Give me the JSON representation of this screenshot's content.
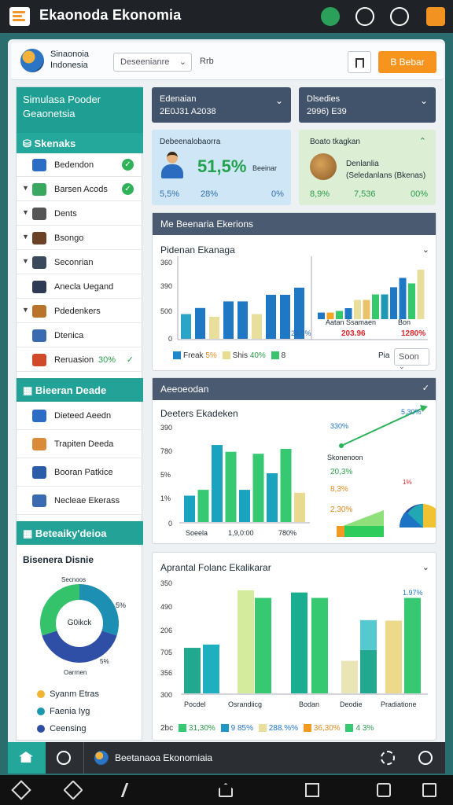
{
  "app": {
    "title": "Ekaonoda Ekonomia"
  },
  "header": {
    "org_line1": "Sinaonoia",
    "org_line2": "Indonesia",
    "dropdown": "Deseenianre",
    "text": "Rrb",
    "button": "B Bebar"
  },
  "sidebar": {
    "title_line1": "Simulasa Pooder",
    "title_line2": "Geaonetsia",
    "group1": "Skenaks",
    "items": [
      {
        "label": "Bedendon",
        "check": true,
        "caret": false
      },
      {
        "label": "Barsen Acods",
        "check": true,
        "caret": true
      },
      {
        "label": "Dents",
        "check": false,
        "caret": true
      },
      {
        "label": "Bsongo",
        "check": false,
        "caret": true
      },
      {
        "label": "Seconrian",
        "check": false,
        "caret": true
      },
      {
        "label": "Anecla Uegand",
        "check": false,
        "caret": false
      },
      {
        "label": "Pdedenkers",
        "check": false,
        "caret": true
      },
      {
        "label": "Dtenica",
        "check": false,
        "caret": false
      },
      {
        "label": "Reruasion",
        "badge": "30%",
        "check": false,
        "caret": false
      }
    ],
    "group2": "Bieeran Deade",
    "items2": [
      {
        "label": "Dieteed Aeedn"
      },
      {
        "label": "Trapiten Deeda"
      },
      {
        "label": "Booran Patkice"
      },
      {
        "label": "Necleae Ekerass"
      }
    ],
    "group3": "Beteaiky'deioa",
    "donut_title": "Bisenera Disnie",
    "donut_top": "Secnoos",
    "donut_center": "G0ikck",
    "donut_right": "5%",
    "donut_r2": "5%",
    "donut_bottom": "Oarrnen",
    "donut_legend": [
      {
        "label": "Syanm Etras",
        "color": "#f1b431"
      },
      {
        "label": "Faenia Iyg",
        "color": "#1b98b0"
      },
      {
        "label": "Ceensing",
        "color": "#2d4fa1"
      }
    ],
    "donut_values": [
      0.3,
      0.4,
      0.3
    ],
    "donut_colors": [
      "#1d8fb2",
      "#2f4ea6",
      "#34c36b"
    ]
  },
  "dropdowns": [
    {
      "label": "Edenaian",
      "value": "2E0J31 A2038"
    },
    {
      "label": "Dlsedies",
      "value": "2996) E39"
    }
  ],
  "cards": [
    {
      "title": "Debeenalobaorra",
      "value": "51,5%",
      "suffix": "Beeinar",
      "stats": [
        "5,5%",
        "28%",
        "0%"
      ]
    },
    {
      "title": "Boato tkagkan",
      "line1": "Denlanlia",
      "line2": "(Seledanlans (Bkenas)",
      "stats": [
        "8,9%",
        "7,536",
        "00%"
      ]
    }
  ],
  "panel1": {
    "title": "Me Beenaria Ekerions",
    "subtitle": "Pidenan Ekanaga",
    "yticks": [
      "360",
      "390",
      "500",
      "0"
    ],
    "legend": [
      {
        "label": "Freak",
        "pct": "5%",
        "color": "#1e88c8"
      },
      {
        "label": "Shis",
        "pct": "40%",
        "color": "#e9dd8f"
      },
      {
        "label": "",
        "pct": "8",
        "color": "#37c46d"
      }
    ],
    "bar_label": "29,5%",
    "sub_label1": "Aatan Ssamaen",
    "sub_label2": "Bon",
    "val1": "203.96",
    "val2": "1280%",
    "filter_label": "Pia",
    "filter_value": "Soon",
    "series1": [
      {
        "v": 0.45,
        "c": "#2aa4c7"
      },
      {
        "v": 0.56,
        "c": "#1e78c4"
      },
      {
        "v": 0.4,
        "c": "#e9df9c"
      },
      {
        "v": 0.68,
        "c": "#1e78c4"
      },
      {
        "v": 0.68,
        "c": "#1e78c4"
      },
      {
        "v": 0.45,
        "c": "#e9df9c"
      },
      {
        "v": 0.8,
        "c": "#1e78c4"
      },
      {
        "v": 0.8,
        "c": "#1e78c4"
      },
      {
        "v": 0.93,
        "c": "#1e78c4"
      }
    ],
    "series2": [
      {
        "v": 0.12,
        "c": "#1e78c4"
      },
      {
        "v": 0.12,
        "c": "#f2a623"
      },
      {
        "v": 0.15,
        "c": "#36c96b"
      },
      {
        "v": 0.2,
        "c": "#1e78c4"
      },
      {
        "v": 0.35,
        "c": "#e9df9c"
      },
      {
        "v": 0.35,
        "c": "#e9c36a"
      },
      {
        "v": 0.45,
        "c": "#36c96b"
      },
      {
        "v": 0.45,
        "c": "#1e98b3"
      },
      {
        "v": 0.58,
        "c": "#1e78c4"
      },
      {
        "v": 0.75,
        "c": "#1e78c4"
      },
      {
        "v": 0.65,
        "c": "#36c96b"
      },
      {
        "v": 0.9,
        "c": "#e9df9c"
      }
    ]
  },
  "panel2": {
    "title": "Aeeoeodan",
    "subtitle": "Deeters Ekadeken",
    "yticks": [
      "390",
      "780",
      "5%",
      "1%",
      "0"
    ],
    "xticks": [
      "Soeela",
      "1,9,0:00",
      "780%"
    ],
    "pcts": [
      "5,30%",
      "330%",
      "Skonenoon",
      "20,3%",
      "8,3%",
      "2,30%",
      "1%",
      "20%"
    ],
    "bars": [
      {
        "v": 0.27,
        "c": "#1aa3bf"
      },
      {
        "v": 0.33,
        "c": "#37c872"
      },
      {
        "v": 0.79,
        "c": "#1aa3bf"
      },
      {
        "v": 0.72,
        "c": "#37c872"
      },
      {
        "v": 0.33,
        "c": "#1aa3bf"
      },
      {
        "v": 0.7,
        "c": "#37c872"
      },
      {
        "v": 0.5,
        "c": "#1aa3bf"
      },
      {
        "v": 0.75,
        "c": "#37c872"
      },
      {
        "v": 0.3,
        "c": "#e9d991"
      }
    ]
  },
  "panel3": {
    "title": "Aprantal Folanc Ekalikarar",
    "yticks": [
      "350",
      "490",
      "206",
      "705",
      "356",
      "300"
    ],
    "xticks": [
      "Pocdel",
      "Osrandiicg",
      "Bodan",
      "Deodie",
      "Pradiatione"
    ],
    "legend": [
      {
        "label": "2bc",
        "pct": "",
        "color": ""
      },
      {
        "label": "",
        "pct": "31,30%",
        "color": "#37c872"
      },
      {
        "label": "",
        "pct": "9 85%",
        "color": "#1e98c4"
      },
      {
        "label": "",
        "pct": "288.%%",
        "color": "#e9df9c"
      },
      {
        "label": "",
        "pct": "36,30%",
        "color": "#f29a23"
      },
      {
        "label": "",
        "pct": "4 3%",
        "color": "#37c872"
      }
    ],
    "pct_top": "1.97%",
    "bars": [
      {
        "base": 0,
        "v": 0.42,
        "c": "#23a890"
      },
      {
        "base": 0,
        "v": 0.45,
        "c": "#1eb0bf"
      },
      {
        "base": 0,
        "v": 0.95,
        "c": "#d4ea9c"
      },
      {
        "base": 0,
        "v": 0.88,
        "c": "#37c872"
      },
      {
        "base": 0,
        "v": 0.93,
        "c": "#1aae91"
      },
      {
        "base": 0,
        "v": 0.88,
        "c": "#37c872"
      },
      {
        "base": 0,
        "v": 0.3,
        "c": "#e9e5b4"
      },
      {
        "base": 0,
        "v": 0.4,
        "c": "#23a890"
      },
      {
        "base": 0.4,
        "v": 0.5,
        "c": "#54c9cf"
      },
      {
        "base": 0,
        "v": 0.67,
        "c": "#ecd98a"
      },
      {
        "base": 0,
        "v": 0.88,
        "c": "#37c872"
      }
    ]
  },
  "bottom": {
    "text": "Beetanaoa Ekonomiaia"
  }
}
